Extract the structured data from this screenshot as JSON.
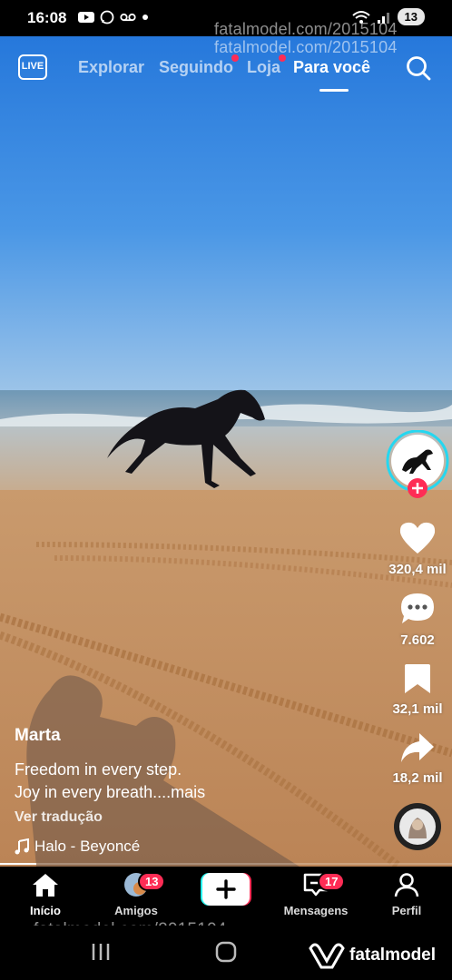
{
  "status_bar": {
    "time": "16:08",
    "battery": "13"
  },
  "watermark": "fatalmodel.com/2015104",
  "brand": {
    "logo_text": "fatalmodel"
  },
  "top_nav": {
    "live_label": "LIVE",
    "tabs": [
      {
        "label": "Explorar",
        "active": false,
        "dot": false
      },
      {
        "label": "Seguindo",
        "active": false,
        "dot": true
      },
      {
        "label": "Loja",
        "active": false,
        "dot": true
      },
      {
        "label": "Para você",
        "active": true,
        "dot": false
      }
    ]
  },
  "rail": {
    "likes": "320,4 mil",
    "comments": "7.602",
    "saves": "32,1 mil",
    "shares": "18,2 mil"
  },
  "caption": {
    "username": "Marta",
    "line1": "Freedom in every step.",
    "line2": "Joy in every breath....mais",
    "translate": "Ver tradução",
    "music": "Halo - Beyoncé"
  },
  "progress": 0.08,
  "bottom_nav": {
    "home": "Início",
    "friends": "Amigos",
    "friends_badge": "13",
    "messages": "Mensagens",
    "messages_badge": "17",
    "profile": "Perfil"
  },
  "colors": {
    "accent": "#fe2c55",
    "cyan": "#25f4ee",
    "sky": "#3c8fe3",
    "sand": "#c99567"
  }
}
